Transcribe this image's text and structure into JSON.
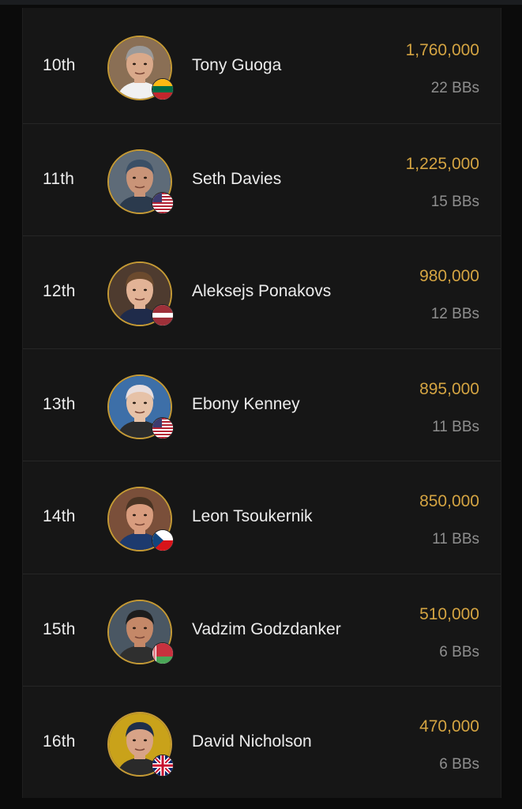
{
  "theme": {
    "accent": "#d4a442",
    "avatar_ring": "#c59a35",
    "panel_bg": "#161616",
    "page_bg": "#0b0b0b",
    "text_primary": "#ececec",
    "text_secondary": "#8e8e8e"
  },
  "players": [
    {
      "rank": "10th",
      "name": "Tony Guoga",
      "chips": "1,760,000",
      "bbs": "22 BBs",
      "flag": "lithuania-flag-icon",
      "skin": "#d9a98a",
      "hair": "#9a9a9a",
      "shirt": "#f1f1f1",
      "bg": "#8a6f55"
    },
    {
      "rank": "11th",
      "name": "Seth Davies",
      "chips": "1,225,000",
      "bbs": "15 BBs",
      "flag": "usa-flag-icon",
      "skin": "#c99478",
      "hair": "#3a4f66",
      "shirt": "#2b3a4d",
      "bg": "#5e6b78"
    },
    {
      "rank": "12th",
      "name": "Aleksejs Ponakovs",
      "chips": "980,000",
      "bbs": "12 BBs",
      "flag": "latvia-flag-icon",
      "skin": "#e2b396",
      "hair": "#6b4a2e",
      "shirt": "#1f2b4a",
      "bg": "#4e3b2f"
    },
    {
      "rank": "13th",
      "name": "Ebony Kenney",
      "chips": "895,000",
      "bbs": "11 BBs",
      "flag": "usa-flag-icon",
      "skin": "#e6c2a8",
      "hair": "#e8dede",
      "shirt": "#2b2b2b",
      "bg": "#3d6fa8"
    },
    {
      "rank": "14th",
      "name": "Leon Tsoukernik",
      "chips": "850,000",
      "bbs": "11 BBs",
      "flag": "czech-flag-icon",
      "skin": "#d89c7e",
      "hair": "#4a3424",
      "shirt": "#1d3a6e",
      "bg": "#7a4f3a"
    },
    {
      "rank": "15th",
      "name": "Vadzim Godzdanker",
      "chips": "510,000",
      "bbs": "6 BBs",
      "flag": "belarus-flag-icon",
      "skin": "#c48868",
      "hair": "#1c1c1c",
      "shirt": "#2f2f2f",
      "bg": "#4a5763"
    },
    {
      "rank": "16th",
      "name": "David Nicholson",
      "chips": "470,000",
      "bbs": "6 BBs",
      "flag": "uk-flag-icon",
      "skin": "#d8a387",
      "hair": "#1e2e4a",
      "shirt": "#2a2a2a",
      "bg": "#c9a21a"
    }
  ]
}
